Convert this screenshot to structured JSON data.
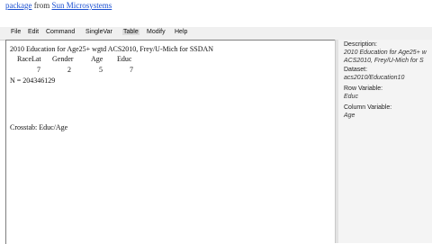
{
  "header": {
    "link_package": "package",
    "from_text": "from",
    "link_vendor": "Sun Microsystems"
  },
  "menu": {
    "items": [
      "File",
      "Edit",
      "Command",
      "SingleVar",
      "Table",
      "Modify",
      "Help"
    ],
    "active_index": 4
  },
  "output": {
    "title": "2010 Education for Age25+ wgtd ACS2010, Frey/U-Mich for SSDAN",
    "columns": [
      "RaceLat",
      "Gender",
      "Age",
      "Educ"
    ],
    "values": [
      "7",
      "2",
      "5",
      "7"
    ],
    "n_line": "N = 204346129",
    "crosstab": "Crosstab: Educ/Age"
  },
  "sidebar": {
    "description_label": "Description:",
    "description_lines": [
      "2010 Education for Age25+ w",
      "ACS2010, Frey/U-Mich for S"
    ],
    "dataset_label": "Dataset:",
    "dataset_value": "acs2010/Education10",
    "row_label": "Row Variable:",
    "row_value": "Educ",
    "column_label": "Column Variable:",
    "column_value": "Age"
  },
  "colors": {
    "link": "#1a4fd1",
    "menubar_bg": "#f0f0f0",
    "sidebar_bg": "#f4f4f4"
  }
}
